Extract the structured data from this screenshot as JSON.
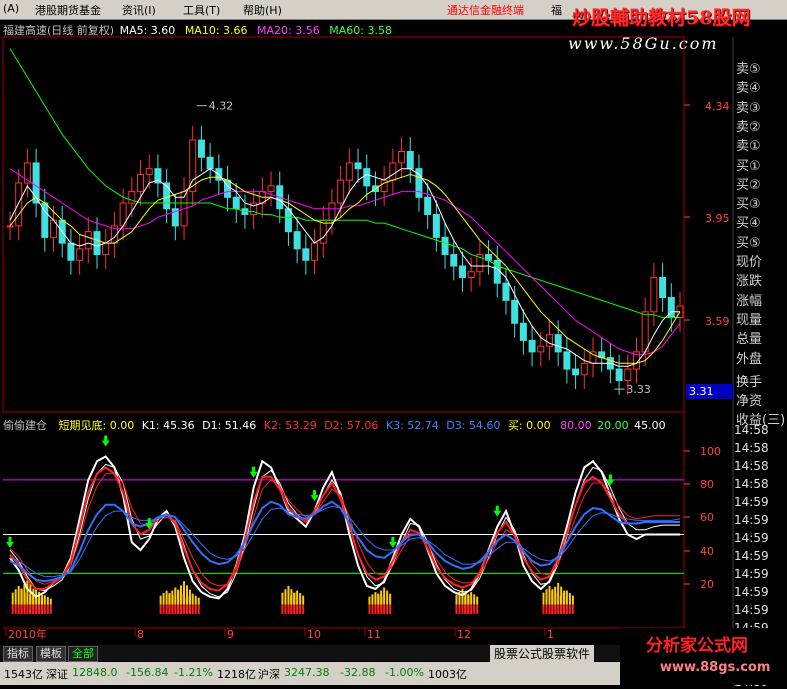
{
  "menu": {
    "items": [
      "(A)",
      "港股期货基金",
      "资讯(I)",
      "工具(T)",
      "帮助(H)"
    ],
    "link": "通达信金融终端",
    "link2": "福"
  },
  "logo": {
    "title": "炒股輔助教材58股网",
    "url": "www.58Gu.com"
  },
  "main_legend": {
    "name": "福建高速(日线 前复权)",
    "ma5": "MA5: 3.60",
    "ma10": "MA10: 3.66",
    "ma20": "MA20: 3.56",
    "ma60": "MA60: 3.58",
    "colors": {
      "ma5": "#ffffff",
      "ma10": "#ffff00",
      "ma20": "#ff00ff",
      "ma60": "#00ff00"
    }
  },
  "indicator_legend": {
    "name": "偷偷建仓",
    "short_bottom": "短期见底: 0.00",
    "k1": "K1: 45.36",
    "d1": "D1: 51.46",
    "k2": "K2: 53.29",
    "d2": "D2: 57.06",
    "k3": "K3: 52.74",
    "d3": "D3: 54.60",
    "buy": "买: 0.00",
    "l80": "80.00",
    "l20": "20.00",
    "l45": "45.00"
  },
  "side_buttons": [
    "卖⑤",
    "卖④",
    "卖③",
    "卖②",
    "卖①",
    "买①",
    "买②",
    "买③",
    "买④",
    "买⑤",
    "现价",
    "涨跌",
    "涨幅",
    "现量",
    "总量",
    "外盘",
    "换手",
    "净资",
    "收益(三)"
  ],
  "price_box": "3.31",
  "time_column": [
    "14:58",
    "14:58",
    "14:58",
    "14:58",
    "14:59",
    "14:59",
    "14:59",
    "14:59",
    "14:59",
    "14:59",
    "14:59",
    "14:59",
    "14:59",
    "14:59",
    "14:59"
  ],
  "tabs": [
    "指标",
    "模板",
    "全部"
  ],
  "status": {
    "amount1": "1543亿",
    "sz_label": "深证",
    "sz_val": "12848.0",
    "sz_chg": "-156.84",
    "sz_pct": "-1.21%",
    "sz_amt": "1218亿",
    "sh_label": "沪深",
    "sh_val": "3247.38",
    "sh_chg": "-32.88",
    "sh_pct": "-1.00%",
    "sh_amt": "1003亿"
  },
  "ads": {
    "formula": "股票公式股票软件",
    "brand": "分析家公式网",
    "brand_url": "www.88gs.com"
  },
  "chart_data": [
    {
      "type": "candlestick",
      "title": "福建高速(日线 前复权)",
      "y_ticks": [
        4.34,
        3.95,
        3.59
      ],
      "ylim": [
        3.25,
        4.56
      ],
      "x_labels": [
        "2010年",
        "8",
        "9",
        "10",
        "11",
        "12",
        "1"
      ],
      "annotations": [
        {
          "text": "4.32",
          "value": 4.32
        },
        {
          "text": "3.33",
          "value": 3.33
        }
      ],
      "close": [
        3.9,
        4.05,
        4.12,
        3.98,
        3.86,
        3.92,
        3.84,
        3.78,
        3.82,
        3.88,
        3.8,
        3.84,
        3.9,
        3.98,
        4.02,
        4.08,
        4.1,
        4.05,
        3.96,
        3.9,
        4.02,
        4.2,
        4.14,
        4.1,
        4.06,
        4.0,
        3.96,
        3.94,
        3.98,
        4.02,
        4.04,
        3.96,
        3.88,
        3.82,
        3.78,
        3.84,
        3.92,
        3.98,
        4.06,
        4.12,
        4.1,
        4.04,
        4.02,
        4.06,
        4.12,
        4.16,
        4.1,
        4.0,
        3.94,
        3.86,
        3.8,
        3.76,
        3.72,
        3.74,
        3.8,
        3.78,
        3.7,
        3.64,
        3.56,
        3.5,
        3.46,
        3.48,
        3.52,
        3.46,
        3.4,
        3.38,
        3.42,
        3.46,
        3.44,
        3.4,
        3.36,
        3.4,
        3.46,
        3.6,
        3.72,
        3.65,
        3.58,
        3.62
      ],
      "ma5": [
        3.92,
        3.98,
        4.04,
        4.0,
        3.95,
        3.92,
        3.88,
        3.84,
        3.83,
        3.84,
        3.83,
        3.84,
        3.86,
        3.9,
        3.95,
        4.0,
        4.05,
        4.06,
        4.04,
        4.0,
        4.0,
        4.06,
        4.08,
        4.1,
        4.08,
        4.04,
        4.02,
        3.98,
        3.97,
        3.98,
        4.0,
        3.99,
        3.96,
        3.92,
        3.88,
        3.84,
        3.86,
        3.9,
        3.96,
        4.02,
        4.06,
        4.08,
        4.07,
        4.06,
        4.08,
        4.1,
        4.1,
        4.08,
        4.04,
        3.98,
        3.91,
        3.85,
        3.8,
        3.76,
        3.76,
        3.76,
        3.75,
        3.72,
        3.66,
        3.6,
        3.55,
        3.51,
        3.49,
        3.48,
        3.47,
        3.45,
        3.43,
        3.42,
        3.42,
        3.42,
        3.41,
        3.41,
        3.42,
        3.46,
        3.52,
        3.57,
        3.6,
        3.6
      ],
      "ma10": [
        3.9,
        3.94,
        3.98,
        4.0,
        3.98,
        3.95,
        3.92,
        3.9,
        3.87,
        3.86,
        3.85,
        3.84,
        3.84,
        3.86,
        3.88,
        3.92,
        3.96,
        3.99,
        4.0,
        4.01,
        4.02,
        4.04,
        4.06,
        4.07,
        4.07,
        4.06,
        4.04,
        4.02,
        4.01,
        4.0,
        4.0,
        3.99,
        3.98,
        3.96,
        3.94,
        3.92,
        3.91,
        3.91,
        3.93,
        3.96,
        3.98,
        4.01,
        4.03,
        4.05,
        4.06,
        4.07,
        4.08,
        4.07,
        4.06,
        4.04,
        4.01,
        3.97,
        3.93,
        3.89,
        3.85,
        3.82,
        3.79,
        3.76,
        3.72,
        3.68,
        3.64,
        3.6,
        3.57,
        3.54,
        3.51,
        3.49,
        3.47,
        3.45,
        3.44,
        3.43,
        3.42,
        3.42,
        3.42,
        3.43,
        3.46,
        3.5,
        3.55,
        3.6
      ],
      "ma20": [
        4.1,
        4.08,
        4.06,
        4.04,
        4.02,
        4.0,
        3.98,
        3.96,
        3.94,
        3.92,
        3.91,
        3.9,
        3.89,
        3.89,
        3.89,
        3.9,
        3.91,
        3.93,
        3.94,
        3.95,
        3.96,
        3.97,
        3.99,
        4.0,
        4.01,
        4.02,
        4.02,
        4.02,
        4.02,
        4.02,
        4.01,
        4.0,
        3.99,
        3.98,
        3.97,
        3.96,
        3.96,
        3.96,
        3.96,
        3.97,
        3.97,
        3.98,
        3.99,
        4.0,
        4.01,
        4.02,
        4.02,
        4.02,
        4.01,
        4.0,
        3.99,
        3.97,
        3.95,
        3.93,
        3.9,
        3.87,
        3.84,
        3.81,
        3.78,
        3.75,
        3.72,
        3.69,
        3.66,
        3.63,
        3.6,
        3.57,
        3.55,
        3.53,
        3.51,
        3.49,
        3.47,
        3.46,
        3.45,
        3.45,
        3.46,
        3.48,
        3.52,
        3.56
      ],
      "ma60": [
        4.52,
        4.47,
        4.42,
        4.37,
        4.32,
        4.27,
        4.22,
        4.18,
        4.14,
        4.1,
        4.07,
        4.04,
        4.02,
        4.0,
        3.99,
        3.98,
        3.98,
        3.98,
        3.98,
        3.98,
        3.98,
        3.98,
        3.98,
        3.98,
        3.97,
        3.96,
        3.96,
        3.95,
        3.95,
        3.94,
        3.94,
        3.93,
        3.93,
        3.93,
        3.92,
        3.92,
        3.92,
        3.92,
        3.92,
        3.92,
        3.92,
        3.92,
        3.91,
        3.91,
        3.9,
        3.89,
        3.88,
        3.87,
        3.86,
        3.85,
        3.84,
        3.83,
        3.82,
        3.8,
        3.79,
        3.78,
        3.76,
        3.75,
        3.74,
        3.73,
        3.72,
        3.71,
        3.7,
        3.69,
        3.68,
        3.67,
        3.66,
        3.65,
        3.64,
        3.63,
        3.62,
        3.61,
        3.6,
        3.59,
        3.59,
        3.58,
        3.58,
        3.58
      ]
    },
    {
      "type": "line",
      "title": "偷偷建仓",
      "y_ticks": [
        100.0,
        80.0,
        60.0,
        40.0,
        20.0
      ],
      "ylim": [
        -15,
        112
      ],
      "h_lines": [
        {
          "value": 80,
          "color": "#ff00ff"
        },
        {
          "value": 45,
          "color": "#ffffff"
        },
        {
          "value": 20,
          "color": "#00ff00"
        }
      ],
      "series": [
        {
          "name": "K1",
          "color": "#ffffff",
          "values": [
            30,
            22,
            10,
            5,
            8,
            14,
            18,
            30,
            55,
            80,
            92,
            95,
            88,
            70,
            40,
            35,
            42,
            55,
            60,
            50,
            30,
            15,
            8,
            5,
            4,
            10,
            25,
            45,
            75,
            92,
            88,
            75,
            60,
            55,
            50,
            60,
            75,
            85,
            70,
            45,
            25,
            12,
            10,
            15,
            30,
            45,
            55,
            50,
            35,
            20,
            12,
            8,
            6,
            10,
            20,
            35,
            50,
            60,
            45,
            25,
            15,
            10,
            15,
            30,
            50,
            72,
            88,
            92,
            85,
            70,
            55,
            45,
            42,
            45,
            45,
            45,
            45,
            45
          ]
        },
        {
          "name": "D1",
          "color": "#ffffff",
          "values": [
            35,
            28,
            18,
            10,
            9,
            12,
            16,
            25,
            45,
            68,
            84,
            90,
            88,
            78,
            55,
            42,
            44,
            52,
            58,
            53,
            38,
            22,
            12,
            7,
            5,
            8,
            20,
            38,
            62,
            82,
            86,
            78,
            65,
            58,
            53,
            58,
            70,
            80,
            72,
            52,
            32,
            18,
            12,
            14,
            26,
            40,
            52,
            51,
            40,
            26,
            16,
            10,
            8,
            9,
            17,
            30,
            45,
            56,
            48,
            32,
            20,
            13,
            14,
            26,
            44,
            64,
            80,
            88,
            86,
            75,
            62,
            52,
            48,
            48,
            50,
            51,
            51,
            51
          ]
        },
        {
          "name": "K2",
          "color": "#ff2020",
          "values": [
            32,
            26,
            16,
            10,
            10,
            14,
            18,
            28,
            50,
            72,
            84,
            88,
            84,
            72,
            52,
            45,
            48,
            56,
            58,
            52,
            36,
            22,
            14,
            10,
            9,
            13,
            24,
            42,
            66,
            82,
            82,
            74,
            62,
            57,
            53,
            60,
            70,
            78,
            68,
            50,
            32,
            20,
            16,
            18,
            28,
            40,
            48,
            46,
            36,
            24,
            17,
            13,
            11,
            13,
            21,
            34,
            46,
            53,
            44,
            30,
            21,
            16,
            18,
            30,
            46,
            64,
            78,
            82,
            78,
            68,
            58,
            52,
            52,
            53,
            53,
            53,
            53,
            53
          ]
        },
        {
          "name": "D2",
          "color": "#ff2020",
          "values": [
            36,
            31,
            22,
            15,
            13,
            15,
            18,
            25,
            42,
            62,
            76,
            84,
            84,
            78,
            62,
            52,
            50,
            54,
            56,
            54,
            42,
            30,
            20,
            14,
            12,
            13,
            21,
            36,
            56,
            74,
            80,
            76,
            67,
            61,
            56,
            58,
            66,
            74,
            70,
            56,
            40,
            27,
            20,
            19,
            25,
            35,
            44,
            45,
            39,
            29,
            21,
            16,
            14,
            14,
            19,
            29,
            40,
            48,
            45,
            35,
            26,
            20,
            19,
            26,
            40,
            56,
            70,
            78,
            78,
            72,
            63,
            57,
            55,
            56,
            57,
            57,
            57,
            57
          ]
        },
        {
          "name": "K3",
          "color": "#3070ff",
          "values": [
            28,
            25,
            20,
            16,
            15,
            16,
            18,
            22,
            34,
            48,
            58,
            64,
            64,
            60,
            52,
            50,
            52,
            56,
            58,
            56,
            48,
            40,
            33,
            28,
            26,
            27,
            32,
            40,
            52,
            62,
            66,
            64,
            58,
            56,
            55,
            58,
            63,
            66,
            62,
            52,
            43,
            35,
            31,
            30,
            34,
            40,
            45,
            45,
            40,
            33,
            28,
            25,
            23,
            24,
            28,
            34,
            41,
            45,
            41,
            34,
            28,
            25,
            26,
            31,
            40,
            50,
            58,
            62,
            61,
            57,
            53,
            52,
            52,
            53,
            53,
            53,
            53,
            53
          ]
        },
        {
          "name": "D3",
          "color": "#3070ff",
          "values": [
            30,
            28,
            24,
            20,
            18,
            18,
            19,
            21,
            29,
            40,
            50,
            57,
            60,
            60,
            56,
            54,
            54,
            55,
            57,
            56,
            51,
            45,
            39,
            33,
            30,
            29,
            31,
            36,
            45,
            55,
            61,
            62,
            60,
            58,
            57,
            58,
            61,
            63,
            62,
            56,
            49,
            42,
            37,
            35,
            35,
            38,
            42,
            43,
            41,
            37,
            32,
            29,
            26,
            26,
            27,
            31,
            36,
            40,
            40,
            36,
            32,
            29,
            28,
            30,
            36,
            44,
            51,
            57,
            59,
            58,
            56,
            55,
            54,
            54,
            54,
            54,
            54,
            55
          ]
        }
      ],
      "arrows_down": [
        0,
        11,
        16,
        28,
        35,
        44,
        56,
        69
      ],
      "volume_bars_yellow": [
        [
          1,
          12
        ],
        [
          2,
          16
        ],
        [
          3,
          10
        ],
        [
          4,
          6
        ],
        [
          18,
          9
        ],
        [
          19,
          11
        ],
        [
          20,
          15
        ],
        [
          21,
          7
        ],
        [
          32,
          12
        ],
        [
          33,
          9
        ],
        [
          42,
          8
        ],
        [
          43,
          11
        ],
        [
          52,
          10
        ],
        [
          53,
          8
        ],
        [
          62,
          12
        ],
        [
          63,
          14
        ],
        [
          64,
          9
        ]
      ]
    }
  ]
}
